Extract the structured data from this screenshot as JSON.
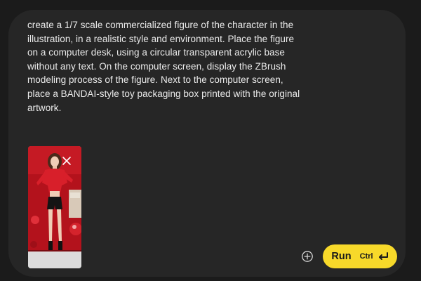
{
  "prompt": {
    "text": "create a 1/7 scale commercialized figure of the character in the illustration, in a realistic style and environment. Place the figure on a computer desk, using a circular transparent acrylic base without any text. On the computer screen, display the ZBrush modeling process of the figure. Next to the computer screen, place a BANDAI-style toy packaging box printed with the original artwork."
  },
  "attachment": {
    "remove_icon": "close-icon",
    "image_description_icon": "photo-thumbnail"
  },
  "actions": {
    "add_icon": "plus-circle-icon",
    "run_label": "Run",
    "run_shortcut": "Ctrl",
    "run_shortcut_icon": "enter-key-icon"
  },
  "colors": {
    "panel_bg": "#262626",
    "page_bg": "#1b1b1b",
    "run_button": "#f7d92a",
    "text": "#ebebeb"
  }
}
